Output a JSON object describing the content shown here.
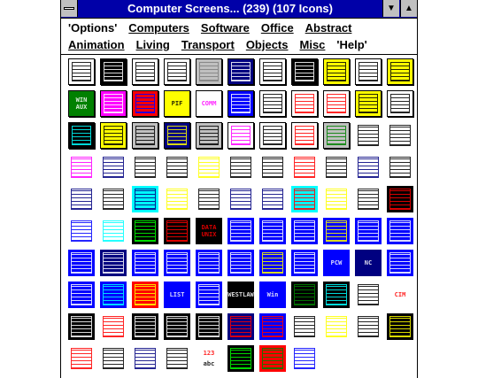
{
  "window": {
    "title": "Computer Screens... (239) (107 Icons)",
    "system_menu_icon": "system-menu-icon",
    "minimize_icon": "minimize-arrow-icon",
    "maximize_icon": "maximize-arrow-icon",
    "title_bar_color": "#0000a8"
  },
  "menu": {
    "row1": [
      "'Options'",
      "Computers",
      "Software",
      "Office",
      "Abstract"
    ],
    "row2": [
      "Animation",
      "Living",
      "Transport",
      "Objects",
      "Misc",
      "'Help'"
    ]
  },
  "icons": [
    {
      "name": "blank-window-icon",
      "bg": "#ffffff",
      "fg": "#000000",
      "bd": true
    },
    {
      "name": "grid-window-icon",
      "bg": "#000000",
      "fg": "#ffffff",
      "bd": true
    },
    {
      "name": "window-icon",
      "bg": "#ffffff",
      "fg": "#000000",
      "bd": true
    },
    {
      "name": "list-window-icon",
      "bg": "#ffffff",
      "fg": "#000000",
      "bd": true
    },
    {
      "name": "dotted-window-icon",
      "bg": "#c0c0c0",
      "fg": "#808080",
      "bd": true
    },
    {
      "name": "star-window-icon",
      "bg": "#000080",
      "fg": "#ffffff",
      "bd": true
    },
    {
      "name": "frame-window-icon",
      "bg": "#ffffff",
      "fg": "#000000",
      "bd": true
    },
    {
      "name": "monitor-icon",
      "bg": "#000000",
      "fg": "#ffffff",
      "bd": true
    },
    {
      "name": "smiley-window-icon",
      "bg": "#ffff00",
      "fg": "#000000",
      "bd": true
    },
    {
      "name": "chip-window-icon",
      "bg": "#ffffff",
      "fg": "#000000",
      "bd": true
    },
    {
      "name": "face-window-icon",
      "bg": "#ffff00",
      "fg": "#000000",
      "bd": true
    },
    {
      "name": "win-aux-icon",
      "bg": "#008000",
      "fg": "#ffffff",
      "bd": true
    },
    {
      "name": "dollar-icon",
      "bg": "#ff00ff",
      "fg": "#ffffff",
      "bd": true
    },
    {
      "name": "shop-icon",
      "bg": "#ff0000",
      "fg": "#0000ff",
      "bd": true
    },
    {
      "name": "pif-icon",
      "bg": "#ffff00",
      "fg": "#000000",
      "bd": true
    },
    {
      "name": "comm-icon",
      "bg": "#ffffff",
      "fg": "#ff00ff",
      "bd": true
    },
    {
      "name": "floppy-icon",
      "bg": "#0000ff",
      "fg": "#ffffff",
      "bd": true
    },
    {
      "name": "document-window-icon",
      "bg": "#ffffff",
      "fg": "#000000",
      "bd": true
    },
    {
      "name": "left-arrow-icon",
      "bg": "#ffffff",
      "fg": "#ff0000",
      "bd": true
    },
    {
      "name": "right-arrow-icon",
      "bg": "#ffffff",
      "fg": "#ff0000",
      "bd": true
    },
    {
      "name": "key-icon",
      "bg": "#ffff00",
      "fg": "#000000",
      "bd": true
    },
    {
      "name": "no-entry-icon",
      "bg": "#ffffff",
      "fg": "#000000",
      "bd": true
    },
    {
      "name": "keypad-icon",
      "bg": "#000000",
      "fg": "#00ffff",
      "bd": true
    },
    {
      "name": "sunglasses-icon",
      "bg": "#ffff00",
      "fg": "#000000",
      "bd": true
    },
    {
      "name": "app-grid-icon",
      "bg": "#c0c0c0",
      "fg": "#000000",
      "bd": true
    },
    {
      "name": "color-grid-icon",
      "bg": "#000080",
      "fg": "#ffff00",
      "bd": true
    },
    {
      "name": "button-panel-icon",
      "bg": "#c0c0c0",
      "fg": "#000000",
      "bd": true
    },
    {
      "name": "paint-icon",
      "bg": "#ffffff",
      "fg": "#ff00ff",
      "bd": true
    },
    {
      "name": "empty-window-icon",
      "bg": "#ffffff",
      "fg": "#000000",
      "bd": true
    },
    {
      "name": "bar-chart-icon",
      "bg": "#ffffff",
      "fg": "#ff0000",
      "bd": true
    },
    {
      "name": "control-panel-icon",
      "bg": "#c0c0c0",
      "fg": "#008000",
      "bd": true
    },
    {
      "name": "text-window-icon",
      "bg": "#ffffff",
      "fg": "#000000",
      "bd": false
    },
    {
      "name": "list-view-icon",
      "bg": "#ffffff",
      "fg": "#000000",
      "bd": false
    },
    {
      "name": "color-palette-icon",
      "bg": "#ffffff",
      "fg": "#ff00ff",
      "bd": false
    },
    {
      "name": "program-group-icon",
      "bg": "#ffffff",
      "fg": "#000080",
      "bd": false
    },
    {
      "name": "spreadsheet-icon",
      "bg": "#ffffff",
      "fg": "#000000",
      "bd": false
    },
    {
      "name": "table-icon",
      "bg": "#ffffff",
      "fg": "#000000",
      "bd": false
    },
    {
      "name": "face-dialog-icon",
      "bg": "#ffffff",
      "fg": "#ffff00",
      "bd": false
    },
    {
      "name": "calculator-icon",
      "bg": "#ffffff",
      "fg": "#000000",
      "bd": false
    },
    {
      "name": "form-icon",
      "bg": "#ffffff",
      "fg": "#000000",
      "bd": false
    },
    {
      "name": "dots-grid-icon",
      "bg": "#ffffff",
      "fg": "#ff0000",
      "bd": false
    },
    {
      "name": "dice-icon",
      "bg": "#ffffff",
      "fg": "#000000",
      "bd": false
    },
    {
      "name": "stacked-windows-icon",
      "bg": "#ffffff",
      "fg": "#000080",
      "bd": false
    },
    {
      "name": "cascade-icon",
      "bg": "#ffffff",
      "fg": "#000000",
      "bd": false
    },
    {
      "name": "tiled-windows-icon",
      "bg": "#ffffff",
      "fg": "#000080",
      "bd": false
    },
    {
      "name": "file-manager-icon",
      "bg": "#ffffff",
      "fg": "#000000",
      "bd": false
    },
    {
      "name": "dialog-icon",
      "bg": "#00ffff",
      "fg": "#000080",
      "bd": false
    },
    {
      "name": "smiley-dialog-icon",
      "bg": "#ffffff",
      "fg": "#ffff00",
      "bd": false
    },
    {
      "name": "pointer-hand-icon",
      "bg": "#ffffff",
      "fg": "#000000",
      "bd": false
    },
    {
      "name": "small-window-icon",
      "bg": "#ffffff",
      "fg": "#000080",
      "bd": false
    },
    {
      "name": "edit-window-icon",
      "bg": "#ffffff",
      "fg": "#000080",
      "bd": false
    },
    {
      "name": "target-window-icon",
      "bg": "#00ffff",
      "fg": "#ff0000",
      "bd": false
    },
    {
      "name": "diamond-window-icon",
      "bg": "#ffffff",
      "fg": "#ffff00",
      "bd": false
    },
    {
      "name": "tools-icon",
      "bg": "#ffffff",
      "fg": "#000000",
      "bd": false
    },
    {
      "name": "red-grid-icon",
      "bg": "#000000",
      "fg": "#ff0000",
      "bd": false
    },
    {
      "name": "blue-list-icon",
      "bg": "#ffffff",
      "fg": "#0000ff",
      "bd": false
    },
    {
      "name": "cyan-grid-icon",
      "bg": "#ffffff",
      "fg": "#00ffff",
      "bd": false
    },
    {
      "name": "tetris-icon",
      "bg": "#000000",
      "fg": "#00ff00",
      "bd": false
    },
    {
      "name": "graph-window-icon",
      "bg": "#000000",
      "fg": "#ff0000",
      "bd": false
    },
    {
      "name": "data-unix-icon",
      "bg": "#000000",
      "fg": "#ff0000",
      "bd": false
    },
    {
      "name": "dos-screen-icon",
      "bg": "#0000ff",
      "fg": "#ffffff",
      "bd": false
    },
    {
      "name": "blue-screen-icon",
      "bg": "#0000ff",
      "fg": "#ffffff",
      "bd": false
    },
    {
      "name": "star-screen-icon",
      "bg": "#0000ff",
      "fg": "#ffffff",
      "bd": false
    },
    {
      "name": "editor-screen-icon",
      "bg": "#0000ff",
      "fg": "#ffff00",
      "bd": false
    },
    {
      "name": "blue-dialog-icon",
      "bg": "#0000ff",
      "fg": "#ffffff",
      "bd": false
    },
    {
      "name": "terminal-screen-icon",
      "bg": "#0000ff",
      "fg": "#ffffff",
      "bd": false
    },
    {
      "name": "list-screen-icon",
      "bg": "#0000ff",
      "fg": "#ffffff",
      "bd": false
    },
    {
      "name": "table-screen-icon",
      "bg": "#000080",
      "fg": "#ffffff",
      "bd": false
    },
    {
      "name": "columns-screen-icon",
      "bg": "#0000ff",
      "fg": "#ffffff",
      "bd": false
    },
    {
      "name": "menu-screen-icon",
      "bg": "#0000ff",
      "fg": "#ffffff",
      "bd": false
    },
    {
      "name": "form-screen-icon",
      "bg": "#0000ff",
      "fg": "#ffffff",
      "bd": false
    },
    {
      "name": "tree-screen-icon",
      "bg": "#0000ff",
      "fg": "#ffffff",
      "bd": false
    },
    {
      "name": "code-screen-icon",
      "bg": "#0000ff",
      "fg": "#ffff00",
      "bd": false
    },
    {
      "name": "blue-panel-icon",
      "bg": "#0000ff",
      "fg": "#ffffff",
      "bd": false
    },
    {
      "name": "pcw-screen-icon",
      "bg": "#0000ff",
      "fg": "#ffffff",
      "bd": false
    },
    {
      "name": "nc-screen-icon",
      "bg": "#000080",
      "fg": "#ffffff",
      "bd": false
    },
    {
      "name": "blueprint-icon",
      "bg": "#0000ff",
      "fg": "#ffffff",
      "bd": false
    },
    {
      "name": "maze-screen-icon",
      "bg": "#0000ff",
      "fg": "#ffffff",
      "bd": false
    },
    {
      "name": "cyan-list-icon",
      "bg": "#0000ff",
      "fg": "#00ffff",
      "bd": false
    },
    {
      "name": "pattern-screen-icon",
      "bg": "#ff0000",
      "fg": "#ffff00",
      "bd": false
    },
    {
      "name": "list-text-icon",
      "bg": "#0000ff",
      "fg": "#ffffff",
      "bd": false
    },
    {
      "name": "data-grid-icon",
      "bg": "#0000ff",
      "fg": "#ffffff",
      "bd": false
    },
    {
      "name": "westlaw-icon",
      "bg": "#000000",
      "fg": "#ffffff",
      "bd": false
    },
    {
      "name": "win-screen-icon",
      "bg": "#0000ff",
      "fg": "#ffffff",
      "bd": false
    },
    {
      "name": "window-border-icon",
      "bg": "#000000",
      "fg": "#008000",
      "bd": false
    },
    {
      "name": "dark-list-icon",
      "bg": "#000000",
      "fg": "#00ffff",
      "bd": false
    },
    {
      "name": "text-editor-icon",
      "bg": "#ffffff",
      "fg": "#000000",
      "bd": false
    },
    {
      "name": "cim-screen-icon",
      "bg": "#ffffff",
      "fg": "#ff0000",
      "bd": false
    },
    {
      "name": "bars-screen-icon",
      "bg": "#000000",
      "fg": "#ffffff",
      "bd": false
    },
    {
      "name": "red-list-icon",
      "bg": "#ffffff",
      "fg": "#ff0000",
      "bd": false
    },
    {
      "name": "white-list-icon",
      "bg": "#000000",
      "fg": "#ffffff",
      "bd": false
    },
    {
      "name": "command-prompt-icon",
      "bg": "#000000",
      "fg": "#ffffff",
      "bd": false
    },
    {
      "name": "text-terminal-icon",
      "bg": "#000000",
      "fg": "#ffffff",
      "bd": false
    },
    {
      "name": "multi-window-icon",
      "bg": "#000080",
      "fg": "#ff0000",
      "bd": false
    },
    {
      "name": "color-blocks-icon",
      "bg": "#0000ff",
      "fg": "#ff0000",
      "bd": false
    },
    {
      "name": "table-window-icon",
      "bg": "#ffffff",
      "fg": "#000000",
      "bd": false
    },
    {
      "name": "yellow-window-icon",
      "bg": "#ffffff",
      "fg": "#ffff00",
      "bd": false
    },
    {
      "name": "notes-window-icon",
      "bg": "#ffffff",
      "fg": "#000000",
      "bd": false
    },
    {
      "name": "chart-window-icon",
      "bg": "#000000",
      "fg": "#ffff00",
      "bd": false
    },
    {
      "name": "split-window-icon",
      "bg": "#ffffff",
      "fg": "#ff0000",
      "bd": false
    },
    {
      "name": "button-grid-icon",
      "bg": "#ffffff",
      "fg": "#000000",
      "bd": false
    },
    {
      "name": "dots-pattern-icon",
      "bg": "#ffffff",
      "fg": "#000080",
      "bd": false
    },
    {
      "name": "sheet-icon",
      "bg": "#ffffff",
      "fg": "#000000",
      "bd": false
    },
    {
      "name": "numbers-letters-icon",
      "bg": "#ffffff",
      "fg": "#ff0000",
      "bd": false
    },
    {
      "name": "dark-dialog-icon",
      "bg": "#000000",
      "fg": "#00ff00",
      "bd": false
    },
    {
      "name": "red-form-icon",
      "bg": "#ff0000",
      "fg": "#008000",
      "bd": false
    },
    {
      "name": "blue-corner-icon",
      "bg": "#ffffff",
      "fg": "#0000ff",
      "bd": false
    }
  ],
  "icon_text": {
    "win_aux": "WIN AUX",
    "pif": "PIF",
    "comm": "COMM",
    "data_unix": "DATA UNIX",
    "pcw": "PCW",
    "nc": "NC",
    "list": "LIST",
    "westlaw": "WESTLAW",
    "win": "Win",
    "cim": "CIM",
    "numbers": "123",
    "letters": "abc"
  }
}
